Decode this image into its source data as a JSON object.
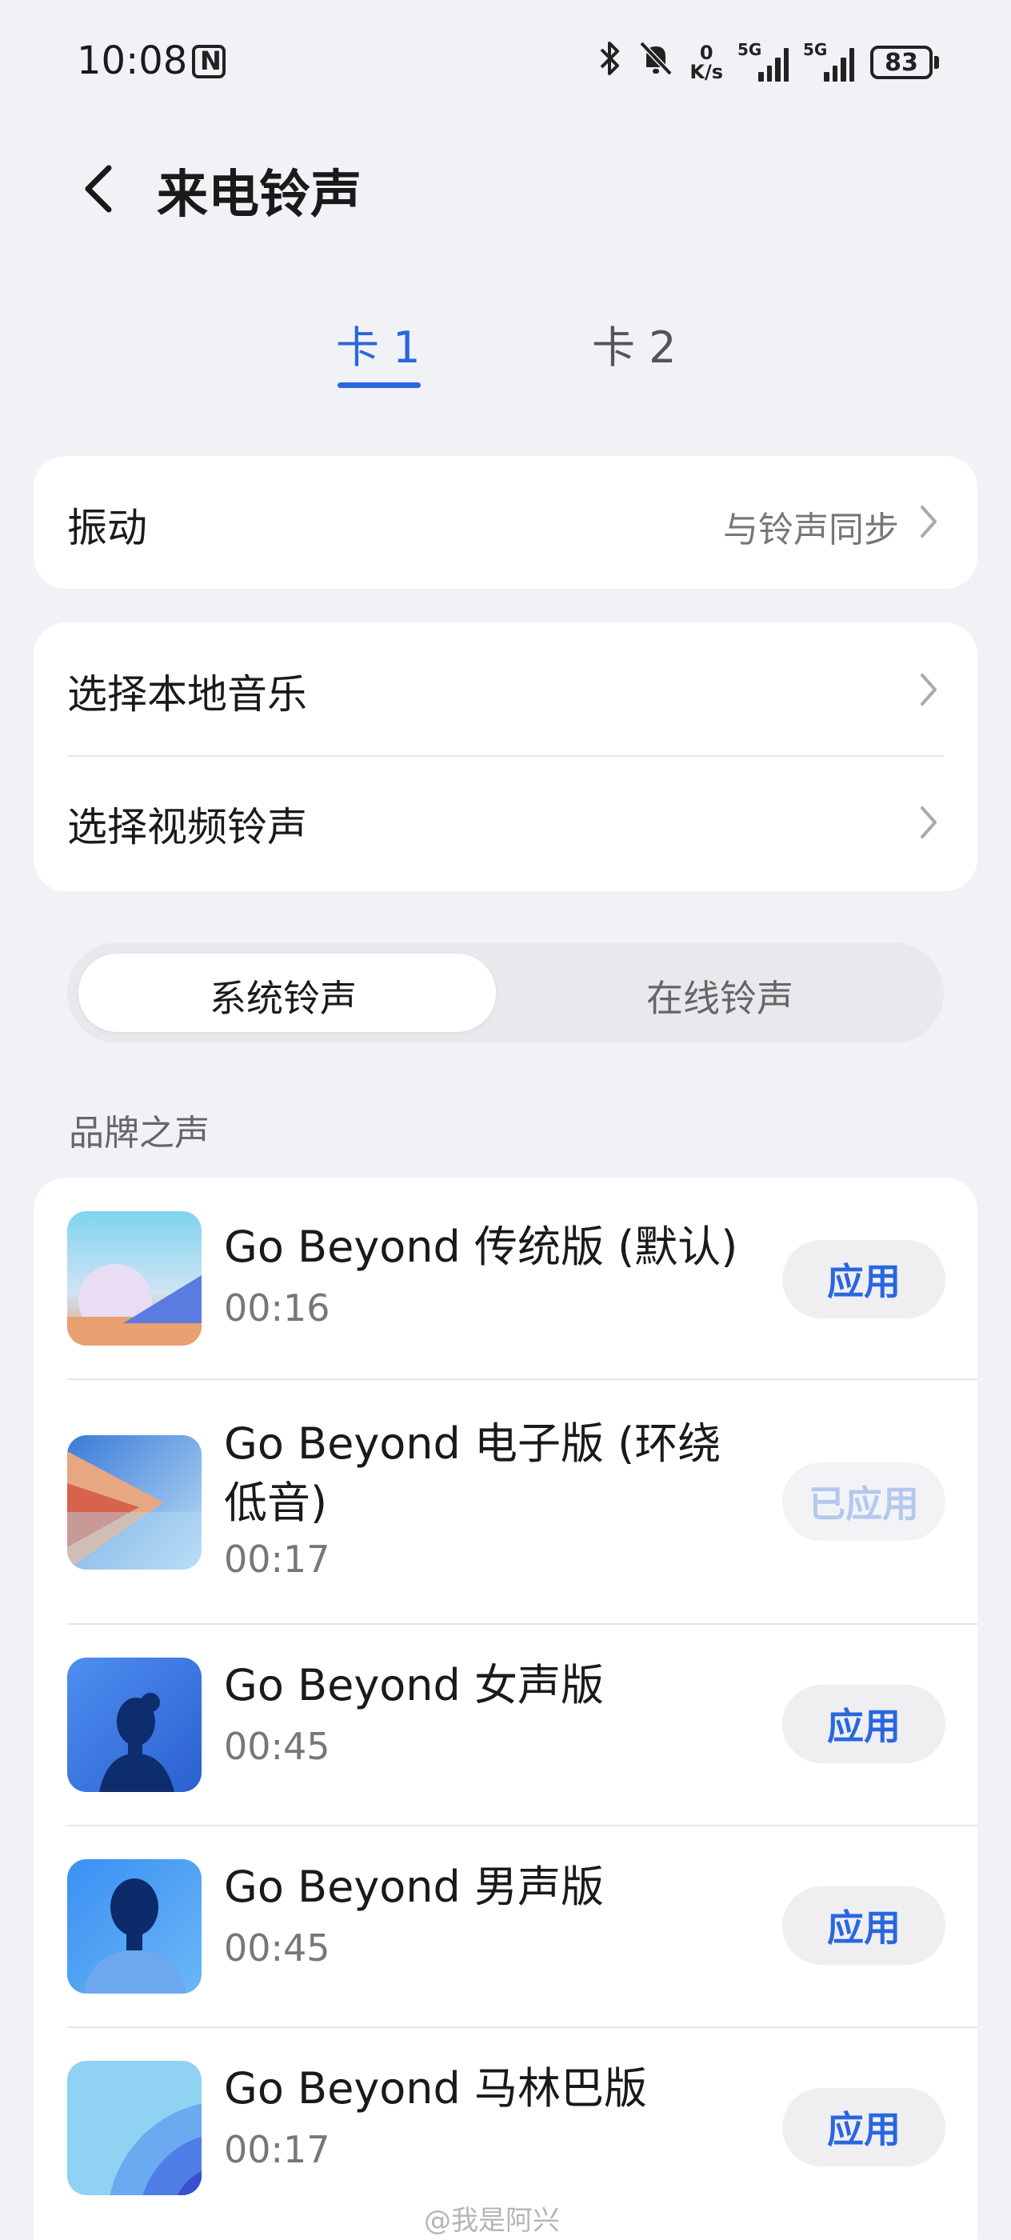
{
  "status_bar": {
    "time": "10:08",
    "net_speed_value": "0",
    "net_speed_unit": "K/s",
    "signal1_label": "5G",
    "signal2_label": "5G",
    "battery": "83"
  },
  "header": {
    "title": "来电铃声"
  },
  "sim_tabs": [
    {
      "label": "卡 1",
      "active": true
    },
    {
      "label": "卡 2",
      "active": false
    }
  ],
  "vibration": {
    "label": "振动",
    "value": "与铃声同步"
  },
  "music_options": [
    {
      "label": "选择本地音乐"
    },
    {
      "label": "选择视频铃声"
    }
  ],
  "segmented": {
    "options": [
      "系统铃声",
      "在线铃声"
    ],
    "selected": "系统铃声"
  },
  "section_title": "品牌之声",
  "ringtones": [
    {
      "title": "Go Beyond 传统版 (默认)",
      "duration": "00:16",
      "button": "应用",
      "applied": false
    },
    {
      "title": "Go Beyond 电子版 (环绕低音)",
      "duration": "00:17",
      "button": "已应用",
      "applied": true
    },
    {
      "title": "Go Beyond 女声版",
      "duration": "00:45",
      "button": "应用",
      "applied": false
    },
    {
      "title": "Go Beyond 男声版",
      "duration": "00:45",
      "button": "应用",
      "applied": false
    },
    {
      "title": "Go Beyond 马林巴版",
      "duration": "00:17",
      "button": "应用",
      "applied": false
    }
  ],
  "watermark": "@我是阿兴",
  "colors": {
    "accent": "#2a67de",
    "background": "#f1f2f6",
    "card": "#ffffff"
  }
}
